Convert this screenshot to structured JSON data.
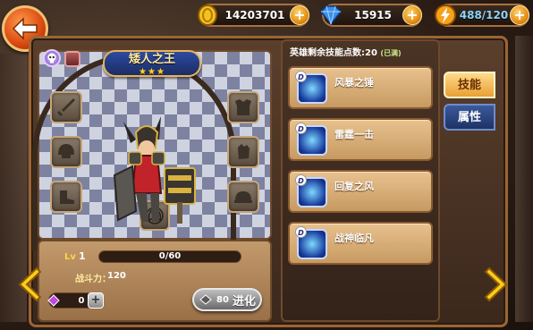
{
  "resources": {
    "gold": "14203701",
    "diamonds": "15915",
    "energy": "488/120"
  },
  "hero": {
    "name": "矮人之王",
    "stars": "★★★",
    "level_label": "Lv",
    "level": "1",
    "xp": "0/60",
    "xp_fraction": 0,
    "power_label": "战斗力：",
    "power": "120",
    "gem_count": "0"
  },
  "evolve": {
    "cost": "80",
    "label": "进化"
  },
  "skills": {
    "header_prefix": "英雄剩余技能点数:",
    "points": "20",
    "points_note": "(已满)",
    "items": [
      {
        "name": "风暴之锤"
      },
      {
        "name": "雷霆一击"
      },
      {
        "name": "回复之风"
      },
      {
        "name": "战神临凡"
      }
    ]
  },
  "tabs": {
    "skills": "技能",
    "attributes": "属性"
  },
  "colors": {
    "accent": "#e8a033",
    "panel": "#c79a62",
    "tab_inactive": "#1e3266"
  }
}
